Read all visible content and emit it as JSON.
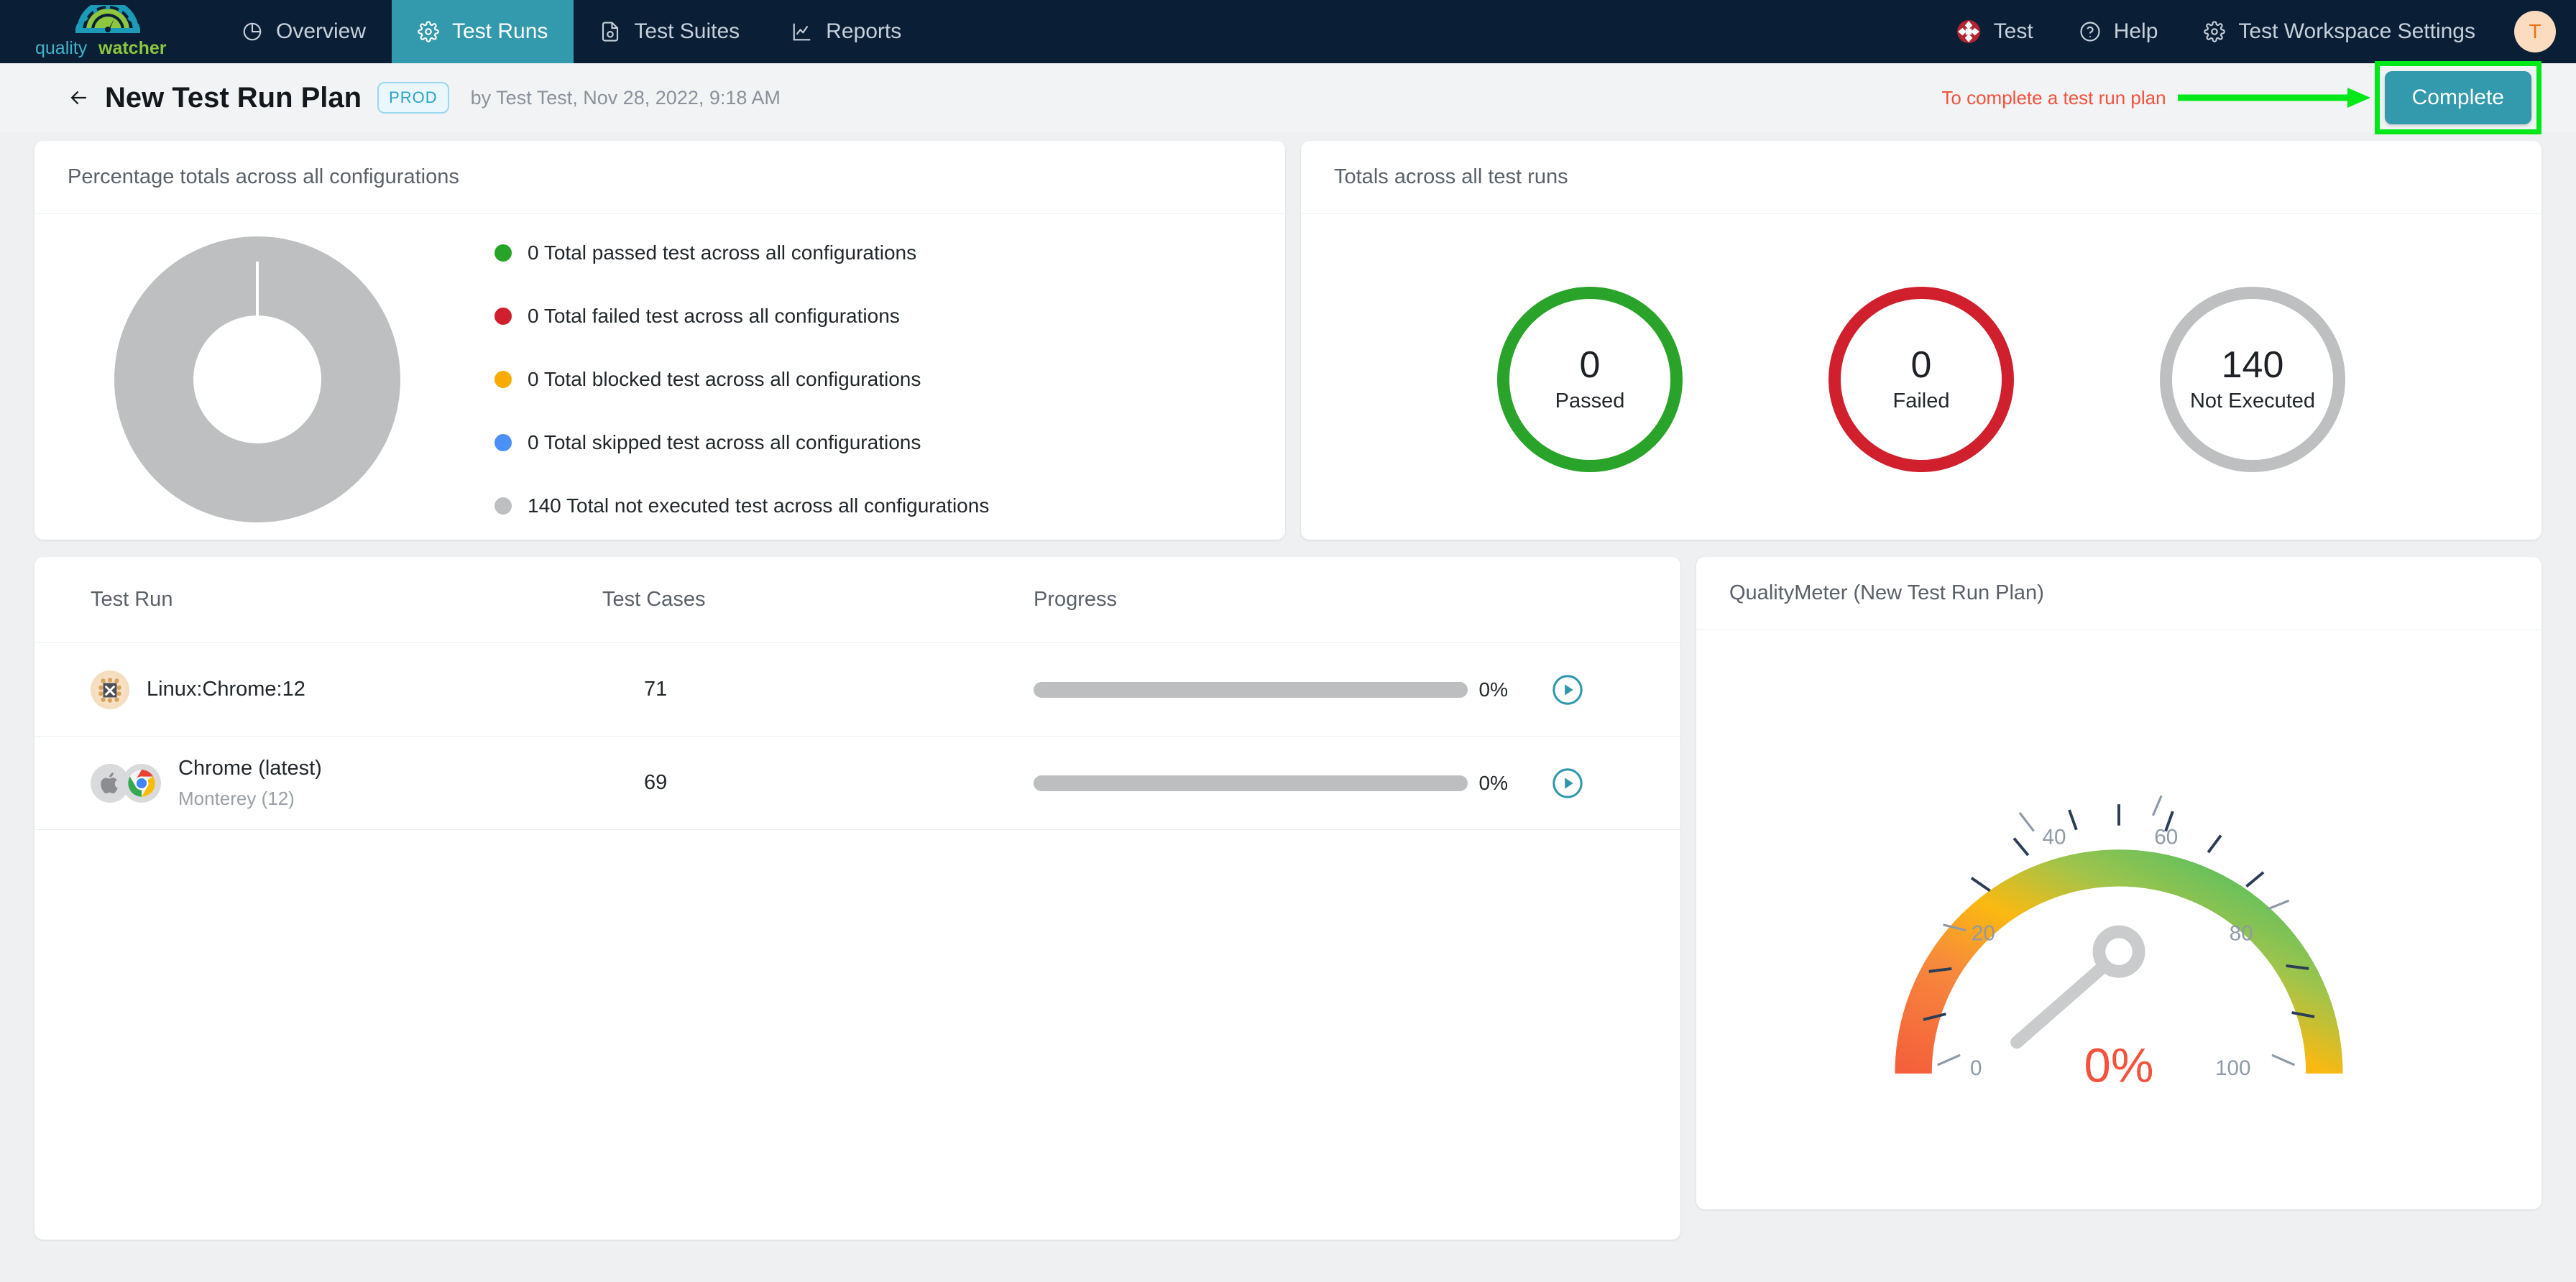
{
  "brand": {
    "name_part1": "quality",
    "name_part2": "watcher"
  },
  "nav": {
    "items": [
      {
        "label": "Overview",
        "icon": "pie-chart-icon",
        "active": false
      },
      {
        "label": "Test Runs",
        "icon": "gear-icon",
        "active": true
      },
      {
        "label": "Test Suites",
        "icon": "document-check-icon",
        "active": false
      },
      {
        "label": "Reports",
        "icon": "line-chart-icon",
        "active": false
      }
    ],
    "right": [
      {
        "label": "Test",
        "icon": "project-icon"
      },
      {
        "label": "Help",
        "icon": "question-circle-icon"
      },
      {
        "label": "Test Workspace Settings",
        "icon": "gear-icon"
      }
    ],
    "avatar_initial": "T",
    "active_tab_color": "#3399ac",
    "bar_color": "#0a1f35"
  },
  "page_header": {
    "back_icon": "arrow-left-icon",
    "title": "New Test Run Plan",
    "env_badge": "PROD",
    "byline": "by Test Test, Nov 28, 2022, 9:18 AM",
    "annotation_text": "To complete a test run plan",
    "annotation_color": "#f4523c",
    "annotation_arrow_color": "#00e817",
    "complete_label": "Complete",
    "complete_color": "#3399ac",
    "highlight_color": "#00e817"
  },
  "percentage_card": {
    "title": "Percentage totals across all configurations"
  },
  "totals_card": {
    "title": "Totals across all test runs",
    "rings": [
      {
        "value": "0",
        "label": "Passed",
        "color": "#2aa32a"
      },
      {
        "value": "0",
        "label": "Failed",
        "color": "#d0202e"
      },
      {
        "value": "140",
        "label": "Not Executed",
        "color": "#bdbfc1"
      }
    ]
  },
  "table": {
    "columns": [
      "Test Run",
      "Test Cases",
      "Progress",
      ""
    ],
    "rows": [
      {
        "name": "Linux:Chrome:12",
        "sub": "",
        "cases": "71",
        "progress": "0%",
        "progress_value": 0,
        "icons": [
          "chip-icon"
        ],
        "action_icon": "play-circle-icon"
      },
      {
        "name": "Chrome (latest)",
        "sub": "Monterey (12)",
        "cases": "69",
        "progress": "0%",
        "progress_value": 0,
        "icons": [
          "apple-icon",
          "chrome-icon"
        ],
        "action_icon": "play-circle-icon"
      }
    ]
  },
  "meter_card": {
    "title": "QualityMeter (New Test Run Plan)",
    "value_label": "0%",
    "value_color": "#f4523c"
  },
  "chart_data": [
    {
      "type": "pie",
      "title": "Percentage totals across all configurations",
      "labels": [
        "0 Total passed test across all configurations",
        "0 Total failed test across all configurations",
        "0 Total blocked test across all configurations",
        "0 Total skipped test across all configurations",
        "140 Total not executed test across all configurations"
      ],
      "values": [
        0,
        0,
        0,
        0,
        140
      ],
      "colors": [
        "#27a327",
        "#d0202e",
        "#f8ab00",
        "#4a90f5",
        "#bdbfc1"
      ],
      "legend": "right",
      "donut": true
    },
    {
      "type": "gauge",
      "title": "QualityMeter (New Test Run Plan)",
      "value": 0,
      "display_value": "0%",
      "min": 0,
      "max": 100,
      "ticks": [
        0,
        20,
        40,
        60,
        80,
        100
      ],
      "gradient": [
        "#f4603c",
        "#f9a33c",
        "#fbb911",
        "#9ec44c",
        "#3bbd6a"
      ]
    }
  ]
}
